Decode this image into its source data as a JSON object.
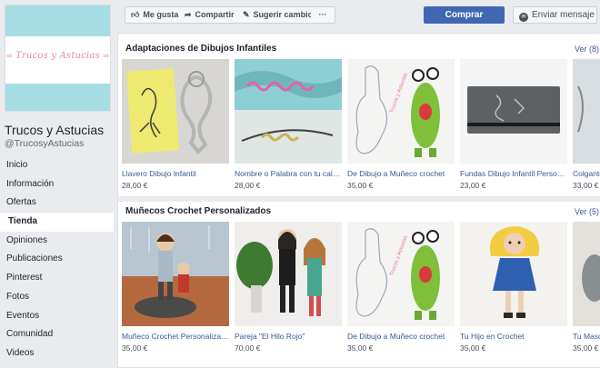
{
  "page": {
    "name": "Trucos y Astucias",
    "handle": "@TrucosyAstucias",
    "cover_logo_text": "Trucos y Astucias"
  },
  "sidebar": {
    "items": [
      {
        "label": "Inicio",
        "active": false
      },
      {
        "label": "Información",
        "active": false
      },
      {
        "label": "Ofertas",
        "active": false
      },
      {
        "label": "Tienda",
        "active": true
      },
      {
        "label": "Opiniones",
        "active": false
      },
      {
        "label": "Publicaciones",
        "active": false
      },
      {
        "label": "Pinterest",
        "active": false
      },
      {
        "label": "Fotos",
        "active": false
      },
      {
        "label": "Eventos",
        "active": false
      },
      {
        "label": "Comunidad",
        "active": false
      },
      {
        "label": "Videos",
        "active": false
      }
    ]
  },
  "toolbar": {
    "like_label": "Me gusta",
    "share_label": "Compartir",
    "suggest_label": "Sugerir cambios",
    "more_label": "···",
    "buy_label": "Comprar",
    "message_label": "Enviar mensaje"
  },
  "sections": [
    {
      "title": "Adaptaciones de Dibujos Infantiles",
      "link": "Ver (8)",
      "products": [
        {
          "name": "Llavero Dibujo Infantil",
          "price": "28,00 €"
        },
        {
          "name": "Nombre o Palabra con tu caligrafía",
          "price": "28,00 €"
        },
        {
          "name": "De Dibujo a Muñeco crochet",
          "price": "35,00 €"
        },
        {
          "name": "Fundas Dibujo Infantil Personalizadas",
          "price": "23,00 €"
        },
        {
          "name": "Colgante",
          "price": "33,00 €"
        }
      ]
    },
    {
      "title": "Muñecos Crochet Personalizados",
      "link": "Ver (5)",
      "products": [
        {
          "name": "Muñeco Crochet Personalizado",
          "price": "35,00 €"
        },
        {
          "name": "Pareja \"El Hilo Rojo\"",
          "price": "70,00 €"
        },
        {
          "name": "De Dibujo a Muñeco crochet",
          "price": "35,00 €"
        },
        {
          "name": "Tu Hijo en Crochet",
          "price": "35,00 €"
        },
        {
          "name": "Tu Masco",
          "price": "35,00 €"
        }
      ]
    }
  ],
  "colors": {
    "accent": "#4267b2",
    "link": "#385898",
    "cover_teal": "#a6dde3",
    "cover_pink": "#e38a9d"
  }
}
